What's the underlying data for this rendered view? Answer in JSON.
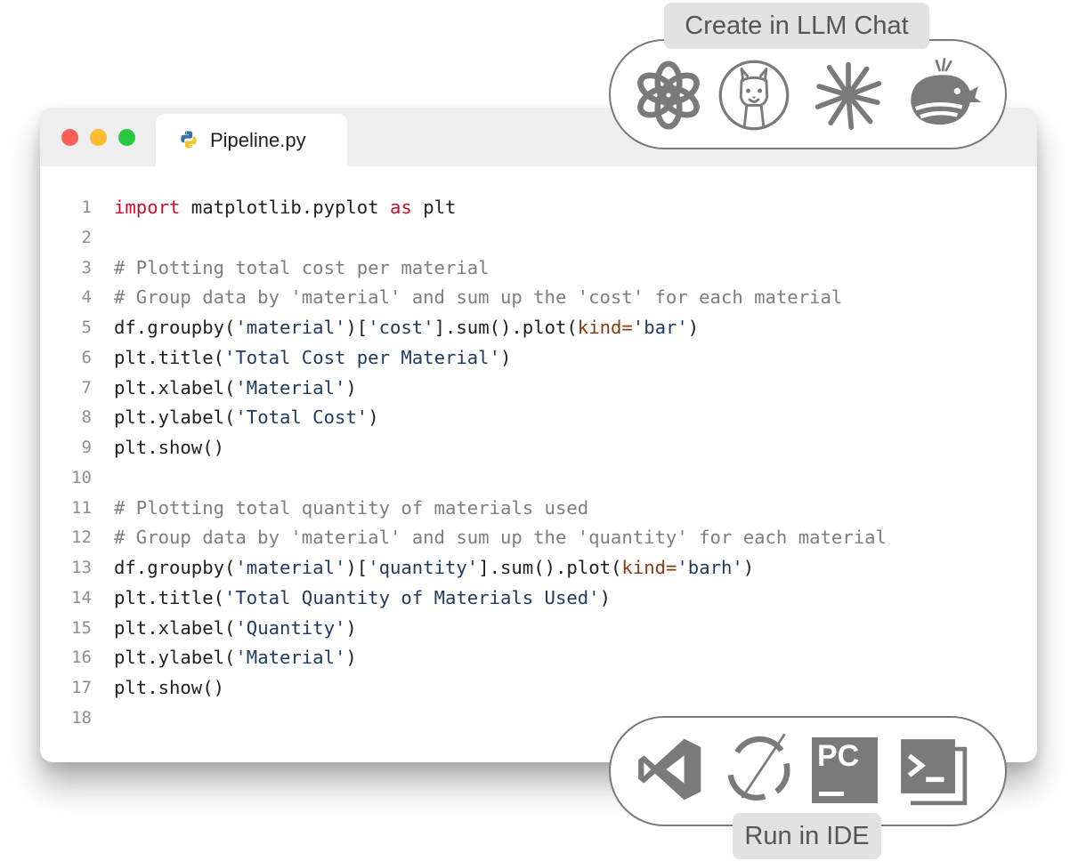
{
  "editor": {
    "tab_filename": "Pipeline.py",
    "icon": "python-icon",
    "lines": [
      {
        "n": "1",
        "tokens": [
          {
            "t": "kw",
            "v": "import"
          },
          {
            "t": "plain",
            "v": " matplotlib.pyplot "
          },
          {
            "t": "kw",
            "v": "as"
          },
          {
            "t": "plain",
            "v": " plt"
          }
        ]
      },
      {
        "n": "2",
        "tokens": []
      },
      {
        "n": "3",
        "tokens": [
          {
            "t": "com",
            "v": "# Plotting total cost per material"
          }
        ]
      },
      {
        "n": "4",
        "tokens": [
          {
            "t": "com",
            "v": "# Group data by 'material' and sum up the 'cost' for each material"
          }
        ]
      },
      {
        "n": "5",
        "tokens": [
          {
            "t": "plain",
            "v": "df.groupby("
          },
          {
            "t": "str",
            "v": "'material'"
          },
          {
            "t": "plain",
            "v": ")["
          },
          {
            "t": "str",
            "v": "'cost'"
          },
          {
            "t": "plain",
            "v": "].sum().plot("
          },
          {
            "t": "kwarg",
            "v": "kind="
          },
          {
            "t": "str",
            "v": "'bar'"
          },
          {
            "t": "plain",
            "v": ")"
          }
        ]
      },
      {
        "n": "6",
        "tokens": [
          {
            "t": "plain",
            "v": "plt.title("
          },
          {
            "t": "str",
            "v": "'Total Cost per Material'"
          },
          {
            "t": "plain",
            "v": ")"
          }
        ]
      },
      {
        "n": "7",
        "tokens": [
          {
            "t": "plain",
            "v": "plt.xlabel("
          },
          {
            "t": "str",
            "v": "'Material'"
          },
          {
            "t": "plain",
            "v": ")"
          }
        ]
      },
      {
        "n": "8",
        "tokens": [
          {
            "t": "plain",
            "v": "plt.ylabel("
          },
          {
            "t": "str",
            "v": "'Total Cost'"
          },
          {
            "t": "plain",
            "v": ")"
          }
        ]
      },
      {
        "n": "9",
        "tokens": [
          {
            "t": "plain",
            "v": "plt.show()"
          }
        ]
      },
      {
        "n": "10",
        "tokens": []
      },
      {
        "n": "11",
        "tokens": [
          {
            "t": "com",
            "v": "# Plotting total quantity of materials used"
          }
        ]
      },
      {
        "n": "12",
        "tokens": [
          {
            "t": "com",
            "v": "# Group data by 'material' and sum up the 'quantity' for each material"
          }
        ]
      },
      {
        "n": "13",
        "tokens": [
          {
            "t": "plain",
            "v": "df.groupby("
          },
          {
            "t": "str",
            "v": "'material'"
          },
          {
            "t": "plain",
            "v": ")["
          },
          {
            "t": "str",
            "v": "'quantity'"
          },
          {
            "t": "plain",
            "v": "].sum().plot("
          },
          {
            "t": "kwarg",
            "v": "kind="
          },
          {
            "t": "str",
            "v": "'barh'"
          },
          {
            "t": "plain",
            "v": ")"
          }
        ]
      },
      {
        "n": "14",
        "tokens": [
          {
            "t": "plain",
            "v": "plt.title("
          },
          {
            "t": "str",
            "v": "'Total Quantity of Materials Used'"
          },
          {
            "t": "plain",
            "v": ")"
          }
        ]
      },
      {
        "n": "15",
        "tokens": [
          {
            "t": "plain",
            "v": "plt.xlabel("
          },
          {
            "t": "str",
            "v": "'Quantity'"
          },
          {
            "t": "plain",
            "v": ")"
          }
        ]
      },
      {
        "n": "16",
        "tokens": [
          {
            "t": "plain",
            "v": "plt.ylabel("
          },
          {
            "t": "str",
            "v": "'Material'"
          },
          {
            "t": "plain",
            "v": ")"
          }
        ]
      },
      {
        "n": "17",
        "tokens": [
          {
            "t": "plain",
            "v": "plt.show()"
          }
        ]
      },
      {
        "n": "18",
        "tokens": []
      }
    ]
  },
  "llm_chat": {
    "label": "Create in LLM Chat",
    "icons": [
      "openai-icon",
      "llama-icon",
      "claude-icon",
      "deepseek-icon"
    ]
  },
  "ide": {
    "label": "Run in IDE",
    "icons": [
      "vscode-icon",
      "spyder-icon",
      "pycharm-icon",
      "terminal-icon"
    ],
    "pycharm_text": "PC"
  },
  "colors": {
    "keyword": "#c8102e",
    "comment": "#7e7e7e",
    "string": "#1e3a5f",
    "kwarg": "#8a3a10",
    "icon_gray": "#7a7a7a"
  }
}
